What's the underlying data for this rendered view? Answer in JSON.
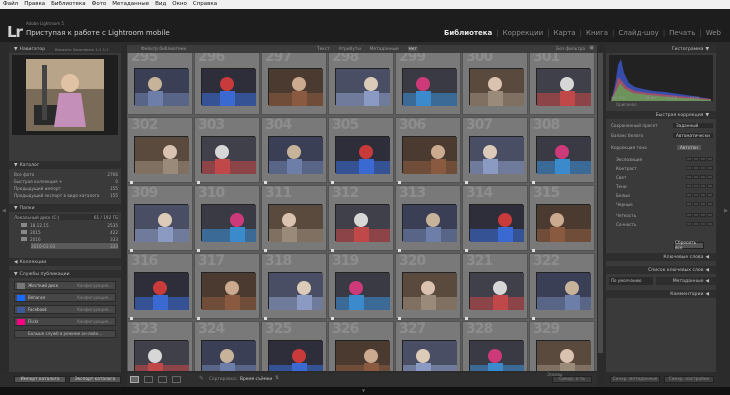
{
  "menubar": {
    "items": [
      "Файл",
      "Правка",
      "Библиотека",
      "Фото",
      "Метаданные",
      "Вид",
      "Окно",
      "Справка"
    ]
  },
  "identity": {
    "logo": "Lr",
    "small": "Adobe Lightroom 5",
    "big": "Приступая к работе с Lightroom mobile"
  },
  "modules": {
    "items": [
      "Библиотека",
      "Коррекции",
      "Карта",
      "Книга",
      "Слайд-шоу",
      "Печать",
      "Web"
    ],
    "active": "Библиотека"
  },
  "navigator": {
    "title": "Навигатор",
    "opts": "Вписать  Заполнить  1:1  1:1"
  },
  "catalog": {
    "title": "Каталог",
    "rows": [
      {
        "label": "Все фото",
        "count": "2766"
      },
      {
        "label": "Быстрая коллекция +",
        "count": "0"
      },
      {
        "label": "Предыдущий импорт",
        "count": "155"
      },
      {
        "label": "Предыдущий экспорт в виде каталога",
        "count": "155"
      }
    ]
  },
  "folders": {
    "title": "Папки",
    "volume": {
      "label": "Локальный диск (C:)",
      "count": "61 / 192 ГБ"
    },
    "rows": [
      {
        "label": "18.12.15",
        "count": "2535"
      },
      {
        "label": "2015",
        "count": "422"
      },
      {
        "label": "2016",
        "count": "333"
      },
      {
        "label": "2016-01-03",
        "count": "333"
      }
    ]
  },
  "collections": {
    "title": "Коллекции"
  },
  "publish": {
    "title": "Службы публикации",
    "rows": [
      {
        "label": "Жесткий диск",
        "setting": "Конфигурация..."
      },
      {
        "label": "Behance",
        "setting": "Конфигурация..."
      },
      {
        "label": "Facebook",
        "setting": "Конфигурация..."
      },
      {
        "label": "Flickr",
        "setting": "Конфигурация..."
      }
    ],
    "more": "Больше служб в режиме он-лайн..."
  },
  "bottom_left": {
    "import": "Импорт каталога",
    "export": "Экспорт каталога"
  },
  "filter": {
    "label": "Фильтр библиотеки",
    "options": [
      "Текст",
      "Атрибуты",
      "Метаданные",
      "Нет"
    ],
    "active": "Нет",
    "preset": "Без фильтра"
  },
  "grid": {
    "cells": [
      {
        "n": "295"
      },
      {
        "n": "296"
      },
      {
        "n": "297"
      },
      {
        "n": "298"
      },
      {
        "n": "299"
      },
      {
        "n": "300"
      },
      {
        "n": "301"
      },
      {
        "n": "302"
      },
      {
        "n": "303"
      },
      {
        "n": "304"
      },
      {
        "n": "305"
      },
      {
        "n": "306"
      },
      {
        "n": "307"
      },
      {
        "n": "308"
      },
      {
        "n": "309"
      },
      {
        "n": "310"
      },
      {
        "n": "311"
      },
      {
        "n": "312"
      },
      {
        "n": "313"
      },
      {
        "n": "314"
      },
      {
        "n": "315"
      },
      {
        "n": "316"
      },
      {
        "n": "317"
      },
      {
        "n": "318"
      },
      {
        "n": "319"
      },
      {
        "n": "320"
      },
      {
        "n": "321"
      },
      {
        "n": "322"
      },
      {
        "n": "323"
      },
      {
        "n": "324"
      },
      {
        "n": "325"
      },
      {
        "n": "326"
      },
      {
        "n": "327"
      },
      {
        "n": "328"
      },
      {
        "n": "329"
      }
    ]
  },
  "toolbar": {
    "sort_label": "Сортировка:",
    "sort_value": "Время съёмки",
    "sync": "Синхр. о-ть",
    "thumbs": "Эскизы"
  },
  "histogram": {
    "title": "Гистограмма",
    "iso": "ISO 100",
    "focal": "18 мм",
    "aperture": "f / 3.5",
    "shutter": "1/125",
    "original": "Оригинал"
  },
  "quick": {
    "title": "Быстрая коррекция",
    "preset_label": "Сохраненный пресет",
    "preset_value": "Заданный",
    "wb_label": "Баланс белого",
    "wb_value": "Автоматически",
    "tone_label": "Коррекция тона",
    "tone_btn": "Автотон",
    "rows": [
      "Экспозиция",
      "Контраст",
      "Свет",
      "Тени",
      "Белые",
      "Черные",
      "Четкость",
      "Сочность"
    ],
    "reset": "Сбросить все"
  },
  "right_panels": {
    "keywording": "Ключевые слова",
    "keyword_list": "Список ключевых слов",
    "metadata_preset": "По умолчанию",
    "metadata": "Метаданные",
    "comments": "Комментарии"
  },
  "bottom_right": {
    "sync_meta": "Синхр. метаданные",
    "sync_settings": "Синхр. настройки"
  },
  "colors": {
    "accent": "#e8e8e8",
    "bg": "#2b2b2b",
    "grid": "#5d5d5d"
  }
}
